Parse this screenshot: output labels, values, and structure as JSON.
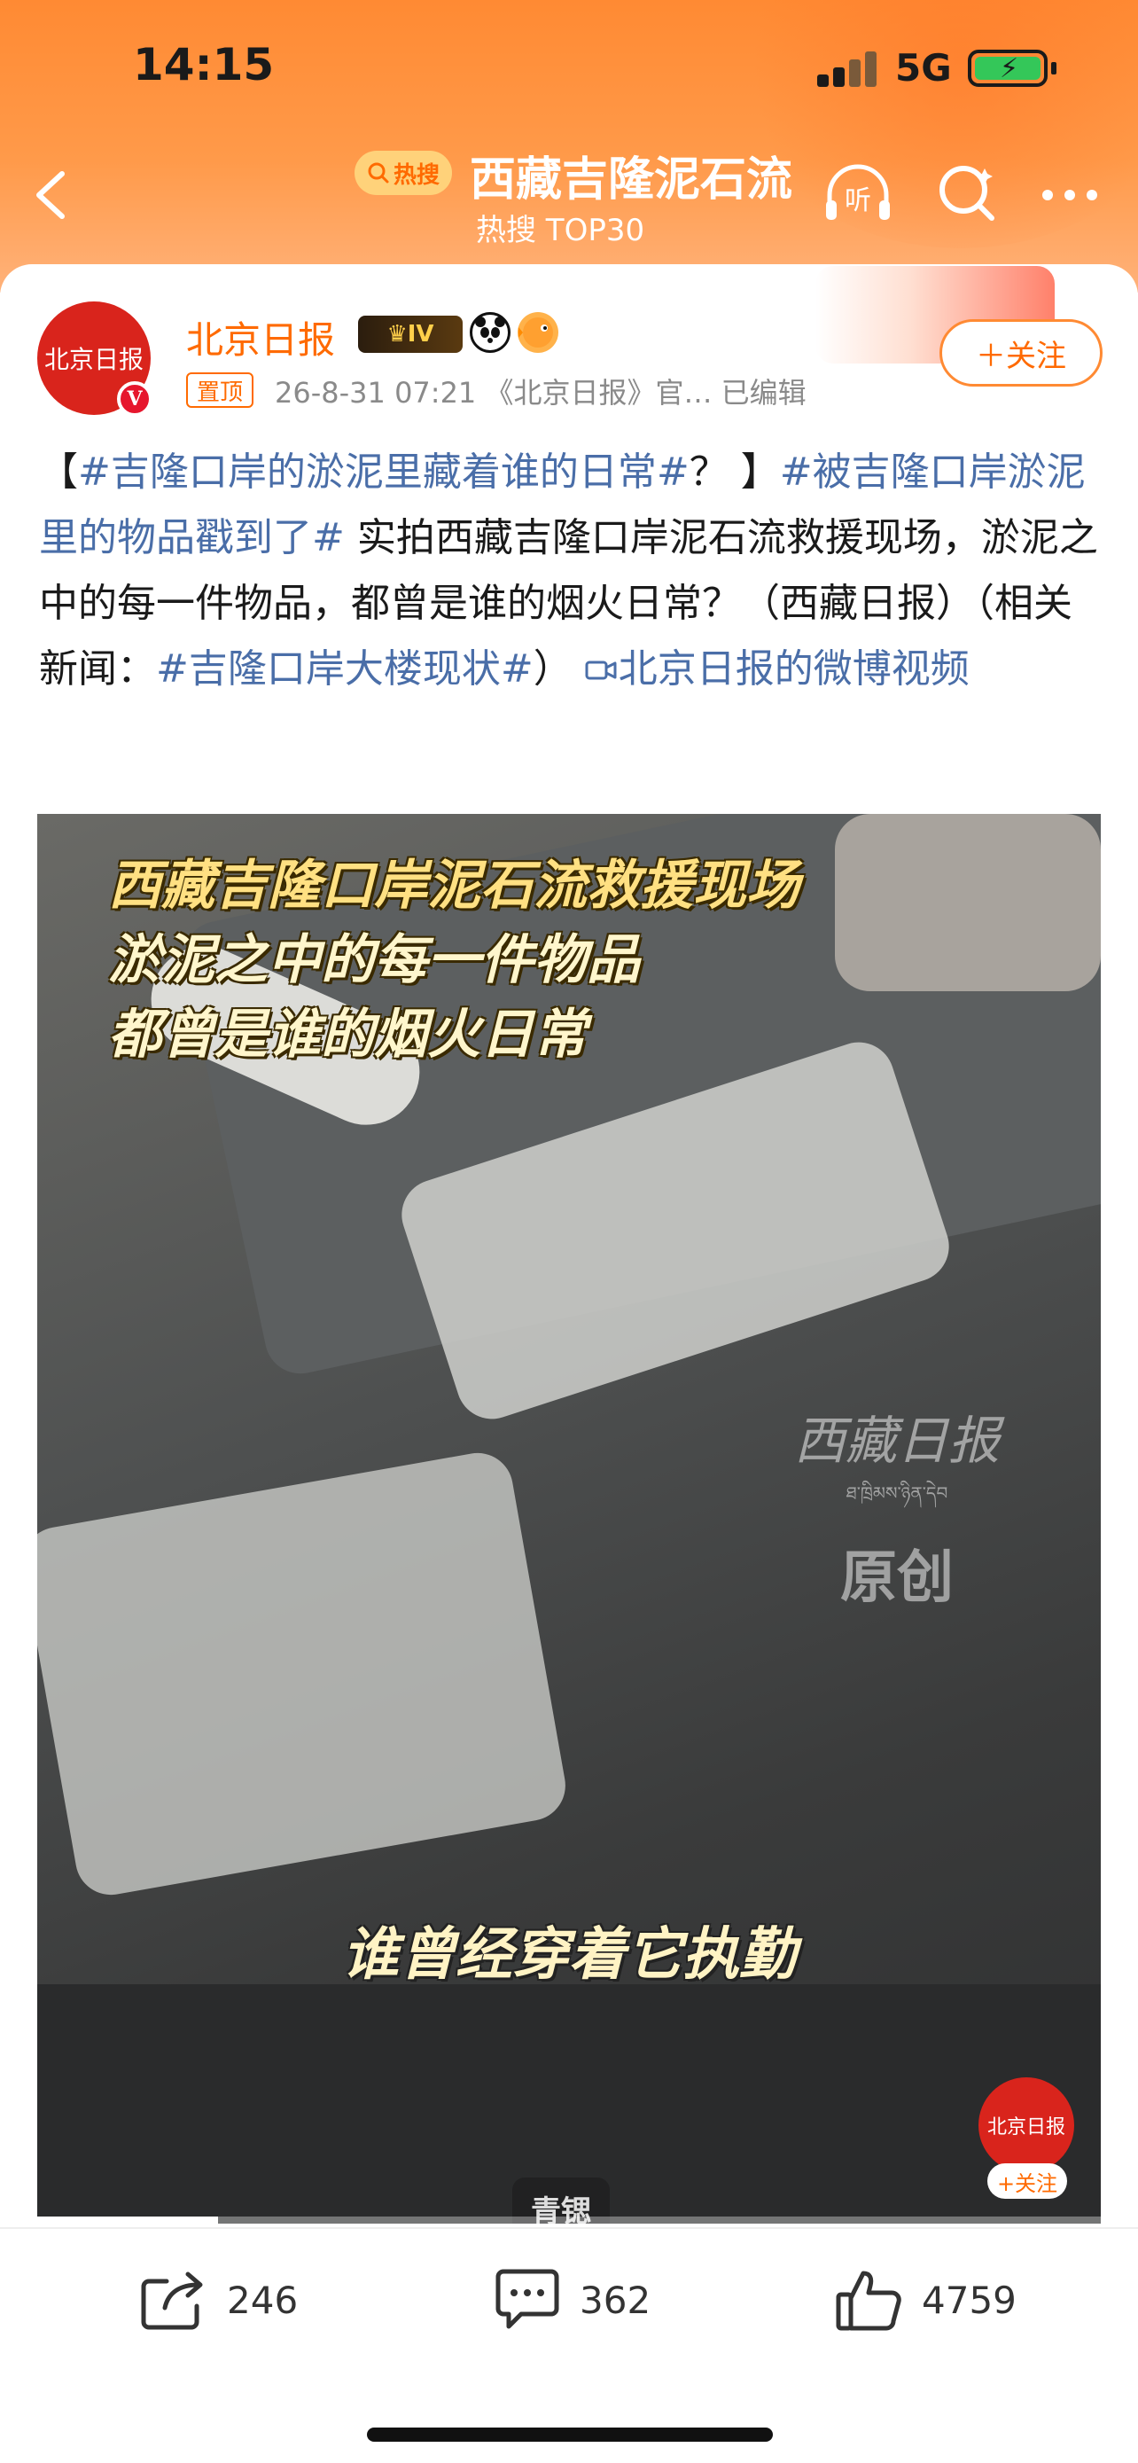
{
  "status_bar": {
    "time": "14:15",
    "network": "5G"
  },
  "header": {
    "topic_badge": "热搜",
    "title": "西藏吉隆泥石流",
    "subtitle": "热搜 TOP30",
    "listen_label": "听"
  },
  "post": {
    "author": "北京日报",
    "vip_level": "IV",
    "avatar_text": "北京日报",
    "pinned_label": "置顶",
    "meta": "26-8-31 07:21  《北京日报》官…  已编辑",
    "follow_label": "＋关注",
    "text": {
      "p1": "【",
      "tag1": "#吉隆口岸的淤泥里藏着谁的日常#",
      "p2": "？ 】",
      "tag2": "#被吉隆口岸淤泥里的物品戳到了#",
      "p3": " 实拍西藏吉隆口岸泥石流救援现场，淤泥之中的每一件物品，都曾是谁的烟火日常？（西藏日报）（相关新闻：",
      "tag3": "#吉隆口岸大楼现状#",
      "p4": "）",
      "video_link": "北京日报的微博视频"
    },
    "video": {
      "overlay_lines": [
        "西藏吉隆口岸泥石流救援现场",
        "淤泥之中的每一件物品",
        "都曾是谁的烟火日常"
      ],
      "watermark_top": "西藏日报",
      "watermark_mid": "ཐ་ཁྲིམས་ཉིན་དེབ",
      "watermark_bottom": "原创",
      "subtitle": "谁曾经穿着它执勤",
      "corner_avatar_text": "北京日报",
      "corner_follow": "+关注",
      "bottom_badge": "青锶",
      "progress": 0.17
    }
  },
  "actions": {
    "share_count": "246",
    "comment_count": "362",
    "like_count": "4759"
  },
  "colors": {
    "accent": "#ff6a00",
    "link": "#4a6ea8",
    "header": "#ff8a33"
  }
}
